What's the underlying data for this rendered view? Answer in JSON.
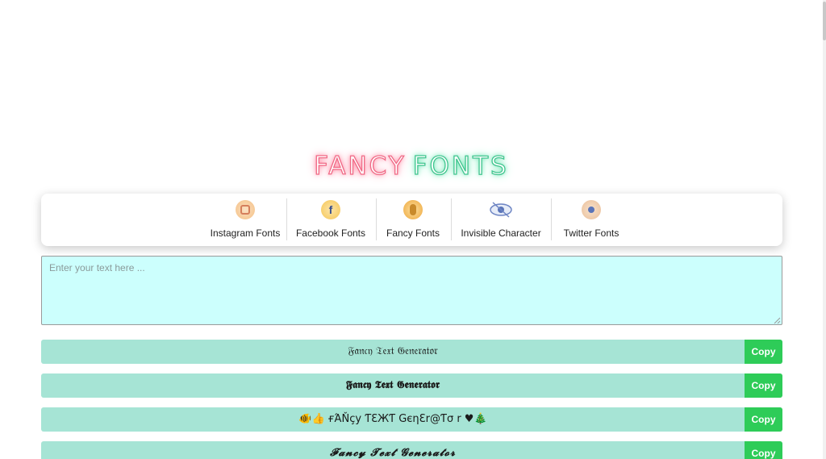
{
  "logo": {
    "part1": "FANCY",
    "part2": "FONTS"
  },
  "nav": {
    "items": [
      {
        "label": "Instagram Fonts",
        "icon": "instagram-icon"
      },
      {
        "label": "Facebook Fonts",
        "icon": "facebook-icon",
        "glyph": "f"
      },
      {
        "label": "Fancy Fonts",
        "icon": "fancy-fonts-icon"
      },
      {
        "label": "Invisible Character",
        "icon": "eye-icon"
      },
      {
        "label": "Twitter Fonts",
        "icon": "twitter-icon"
      }
    ]
  },
  "input": {
    "value": "",
    "placeholder": "Enter your text here ..."
  },
  "results": [
    {
      "text": "𝔉𝔞𝔫𝔠𝔶 𝔗𝔢𝔵𝔱 𝔊𝔢𝔫𝔢𝔯𝔞𝔱𝔬𝔯",
      "copy_label": "Copy"
    },
    {
      "text": "𝕱𝖆𝖓𝖈𝖞 𝕿𝖊𝖝𝖙 𝕲𝖊𝖓𝖊𝖗𝖆𝖙𝖔𝖗",
      "copy_label": "Copy"
    },
    {
      "text": "🐠👍 ғΆŇçу ƬƐЖƬ GєηƐr@Ƭσ r  ♥🎄",
      "copy_label": "Copy"
    },
    {
      "text": "𝓕𝓪𝓷𝓬𝔂 𝓣𝓮𝔁𝓽 𝓖𝓮𝓷𝓮𝓻𝓪𝓽𝓸𝓻",
      "copy_label": "Copy"
    }
  ],
  "colors": {
    "accent_copy": "#2ecc58",
    "row_bg": "#a6e4d5",
    "input_bg": "#ccfffd",
    "logo_pink": "#f06a86",
    "logo_green": "#41c58f"
  }
}
